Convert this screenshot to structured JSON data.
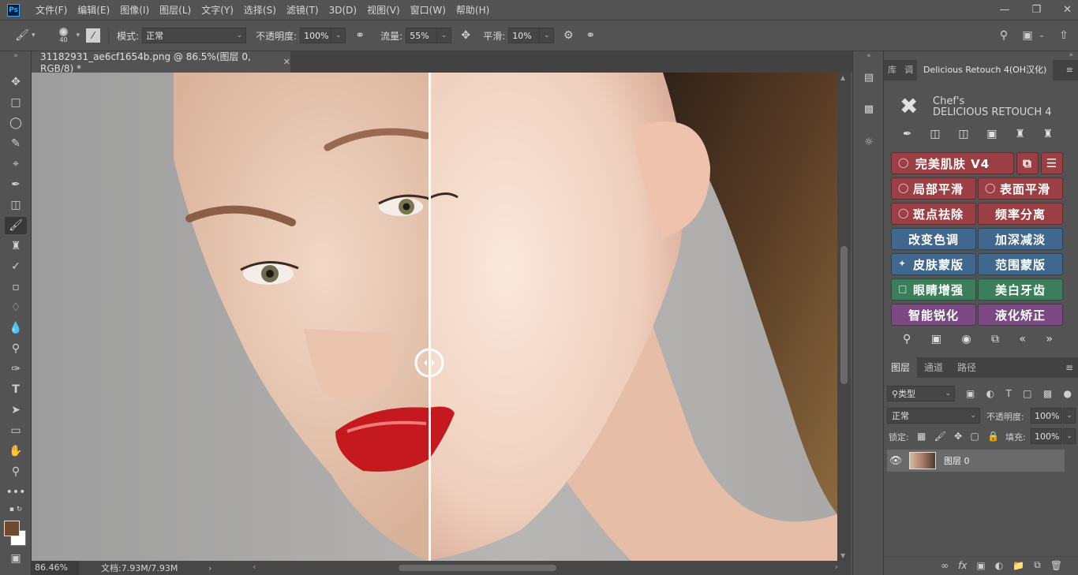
{
  "app": {
    "logo": "Ps"
  },
  "menu": [
    "文件(F)",
    "编辑(E)",
    "图像(I)",
    "图层(L)",
    "文字(Y)",
    "选择(S)",
    "滤镜(T)",
    "3D(D)",
    "视图(V)",
    "窗口(W)",
    "帮助(H)"
  ],
  "options": {
    "brush_size": "40",
    "mode_label": "模式:",
    "mode_value": "正常",
    "opacity_label": "不透明度:",
    "opacity_value": "100%",
    "flow_label": "流量:",
    "flow_value": "55%",
    "smooth_label": "平滑:",
    "smooth_value": "10%"
  },
  "document": {
    "tab_title": "31182931_ae6cf1654b.png @ 86.5%(图层 0, RGB/8) *",
    "zoom": "86.46%",
    "doc_size": "文档:7.93M/7.93M"
  },
  "plugin": {
    "tabs": [
      "库",
      "调",
      "Delicious Retouch 4(OH汉化)"
    ],
    "title": "Chef's",
    "name": "DELICIOUS RETOUCH 4",
    "buttons": {
      "perfect_skin": "完美肌肤 V4",
      "local_smooth": "局部平滑",
      "surface_smooth": "表面平滑",
      "spot_remove": "斑点祛除",
      "freq_sep": "频率分离",
      "change_tone": "改变色调",
      "dodge_burn": "加深减淡",
      "skin_mask": "皮肤蒙版",
      "range_mask": "范围蒙版",
      "eye_enhance": "眼睛增强",
      "teeth_whiten": "美白牙齿",
      "smart_sharpen": "智能锐化",
      "liquify": "液化矫正"
    }
  },
  "layers": {
    "tabs": [
      "图层",
      "通道",
      "路径"
    ],
    "filter": "类型",
    "blend_mode": "正常",
    "opacity_label": "不透明度:",
    "opacity_value": "100%",
    "lock_label": "锁定:",
    "fill_label": "填充:",
    "fill_value": "100%",
    "layer_name": "图层 0"
  }
}
